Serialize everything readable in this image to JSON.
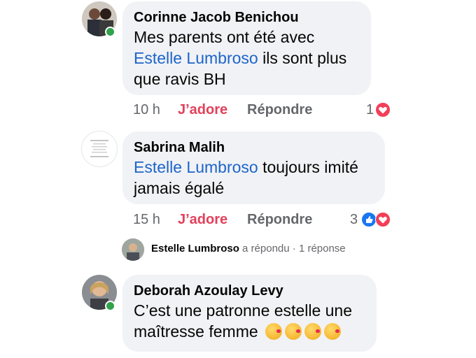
{
  "comments": [
    {
      "author": "Corinne Jacob Benichou",
      "text_parts": {
        "line1": "Mes parents ont été avec",
        "mention": "Estelle Lumbroso",
        "after_mention": " ils sont plus",
        "line3": "que ravis BH"
      },
      "time": "10 h",
      "like_label": "J’adore",
      "reply_label": "Répondre",
      "reaction_count": "1",
      "reactions": [
        "heart-icon"
      ]
    },
    {
      "author": "Sabrina Malih",
      "text_parts": {
        "mention": "Estelle Lumbroso",
        "after_mention": " toujours imité",
        "line2": "jamais égalé"
      },
      "time": "15 h",
      "like_label": "J’adore",
      "reply_label": "Répondre",
      "reaction_count": "3",
      "reactions": [
        "thumb-icon",
        "heart-icon"
      ]
    },
    {
      "author": "Deborah Azoulay Levy",
      "text_parts": {
        "line1": "C’est une patronne estelle une",
        "line2": "maîtresse femme"
      },
      "emojis": [
        "kiss-emoji",
        "kiss-emoji",
        "kiss-emoji",
        "kiss-emoji"
      ]
    }
  ],
  "reply_summary": {
    "name": "Estelle Lumbroso",
    "action": "a répondu",
    "separator": "·",
    "count": "1 réponse"
  },
  "colors": {
    "like": "#e2405a",
    "mention": "#1d64c9",
    "bubble": "#f0f2f5",
    "presence": "#31a24c"
  }
}
